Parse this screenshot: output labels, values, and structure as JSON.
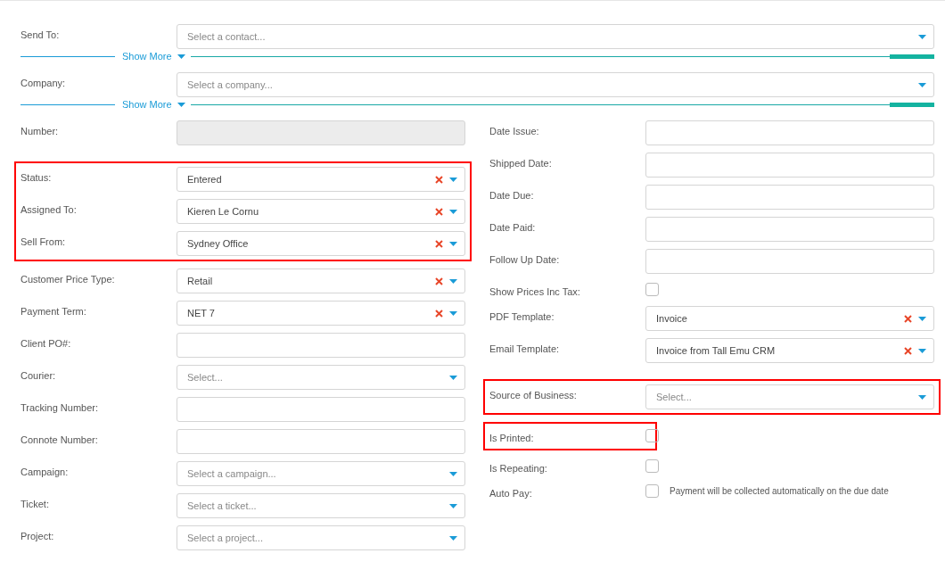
{
  "top_rows": [
    {
      "label": "Send To:",
      "field": {
        "kind": "select",
        "placeholder": "Select a contact...",
        "clearable": false
      }
    },
    {
      "label": "Company:",
      "field": {
        "kind": "select",
        "placeholder": "Select a company...",
        "clearable": false
      }
    }
  ],
  "show_more": [
    "Show More",
    "Show More"
  ],
  "left_column": [
    {
      "highlighted": false,
      "rows": [
        {
          "label": "Number:",
          "field": {
            "kind": "text",
            "disabled": true
          }
        }
      ]
    },
    {
      "highlighted": true,
      "rows": [
        {
          "label": "Status:",
          "field": {
            "kind": "select",
            "value": "Entered",
            "clearable": true
          }
        },
        {
          "label": "Assigned To:",
          "field": {
            "kind": "select",
            "value": "Kieren Le Cornu",
            "clearable": true
          }
        },
        {
          "label": "Sell From:",
          "field": {
            "kind": "select",
            "value": "Sydney Office",
            "clearable": true
          }
        }
      ]
    },
    {
      "highlighted": false,
      "rows": [
        {
          "label": "Customer Price Type:",
          "field": {
            "kind": "select",
            "value": "Retail",
            "clearable": true
          }
        },
        {
          "label": "Payment Term:",
          "field": {
            "kind": "select",
            "value": "NET 7",
            "clearable": true
          }
        },
        {
          "label": "Client PO#:",
          "field": {
            "kind": "text",
            "disabled": false
          }
        },
        {
          "label": "Courier:",
          "field": {
            "kind": "select",
            "placeholder": "Select...",
            "clearable": false
          }
        },
        {
          "label": "Tracking Number:",
          "field": {
            "kind": "text",
            "disabled": false
          }
        },
        {
          "label": "Connote Number:",
          "field": {
            "kind": "text",
            "disabled": false
          }
        },
        {
          "label": "Campaign:",
          "field": {
            "kind": "select",
            "placeholder": "Select a campaign...",
            "clearable": false
          }
        },
        {
          "label": "Ticket:",
          "field": {
            "kind": "select",
            "placeholder": "Select a ticket...",
            "clearable": false
          }
        },
        {
          "label": "Project:",
          "field": {
            "kind": "select",
            "placeholder": "Select a project...",
            "clearable": false
          }
        }
      ]
    }
  ],
  "right_column": [
    {
      "highlighted": false,
      "rows": [
        {
          "label": "Date Issue:",
          "field": {
            "kind": "text",
            "disabled": false
          }
        },
        {
          "label": "Shipped Date:",
          "field": {
            "kind": "text",
            "disabled": false
          }
        },
        {
          "label": "Date Due:",
          "field": {
            "kind": "text",
            "disabled": false
          }
        },
        {
          "label": "Date Paid:",
          "field": {
            "kind": "text",
            "disabled": false
          }
        },
        {
          "label": "Follow Up Date:",
          "field": {
            "kind": "text",
            "disabled": false
          }
        },
        {
          "label": "Show Prices Inc Tax:",
          "field": {
            "kind": "checkbox",
            "checked": false
          }
        },
        {
          "label": "PDF Template:",
          "field": {
            "kind": "select",
            "value": "Invoice",
            "clearable": true
          }
        },
        {
          "label": "Email Template:",
          "field": {
            "kind": "select",
            "value": "Invoice from Tall Emu CRM",
            "clearable": true
          }
        }
      ]
    },
    {
      "highlighted": true,
      "rows": [
        {
          "label": "Source of Business:",
          "field": {
            "kind": "select",
            "placeholder": "Select...",
            "clearable": false
          }
        }
      ]
    },
    {
      "highlighted": true,
      "rows": [
        {
          "label": "Is Printed:",
          "field": {
            "kind": "checkbox",
            "checked": false
          }
        }
      ]
    },
    {
      "highlighted": false,
      "rows": [
        {
          "label": "Is Repeating:",
          "field": {
            "kind": "checkbox",
            "checked": false
          }
        },
        {
          "label": "Auto Pay:",
          "field": {
            "kind": "checkbox",
            "checked": false,
            "note": "Payment will be collected automatically on the due date"
          }
        }
      ]
    }
  ]
}
